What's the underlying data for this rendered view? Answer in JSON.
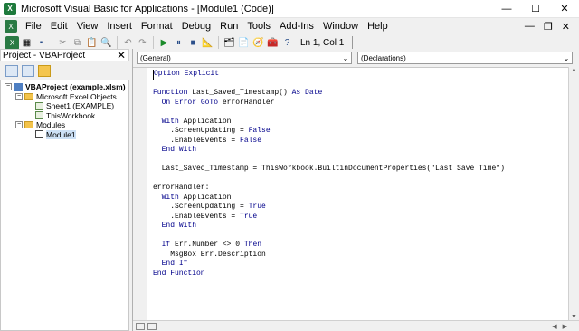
{
  "window": {
    "title": "Microsoft Visual Basic for Applications - [Module1 (Code)]",
    "app_icon": "excel-vba-icon",
    "controls": [
      "minimize-icon",
      "maximize-icon",
      "close-icon"
    ]
  },
  "menu": {
    "items": [
      "File",
      "Edit",
      "View",
      "Insert",
      "Format",
      "Debug",
      "Run",
      "Tools",
      "Add-Ins",
      "Window",
      "Help"
    ]
  },
  "toolbar": {
    "status": "Ln 1, Col 1"
  },
  "project_panel": {
    "title": "Project - VBAProject",
    "tree": [
      {
        "label": "VBAProject (example.xlsm)",
        "icon": "project-icon"
      },
      {
        "label": "Microsoft Excel Objects",
        "icon": "folder-icon"
      },
      {
        "label": "Sheet1 (EXAMPLE)",
        "icon": "sheet-icon"
      },
      {
        "label": "ThisWorkbook",
        "icon": "workbook-icon"
      },
      {
        "label": "Modules",
        "icon": "folder-icon"
      },
      {
        "label": "Module1",
        "icon": "module-icon"
      }
    ]
  },
  "code_window": {
    "object_combo": "(General)",
    "procedure_combo": "(Declarations)",
    "lines": [
      "Option Explicit",
      "",
      "Function Last_Saved_Timestamp() As Date",
      "  On Error GoTo errorHandler",
      "",
      "  With Application",
      "    .ScreenUpdating = False",
      "    .EnableEvents = False",
      "  End With",
      "",
      "  Last_Saved_Timestamp = ThisWorkbook.BuiltinDocumentProperties(\"Last Save Time\")",
      "",
      "errorHandler:",
      "  With Application",
      "    .ScreenUpdating = True",
      "    .EnableEvents = True",
      "  End With",
      "",
      "  If Err.Number <> 0 Then",
      "    MsgBox Err.Description",
      "  End If",
      "End Function"
    ]
  }
}
